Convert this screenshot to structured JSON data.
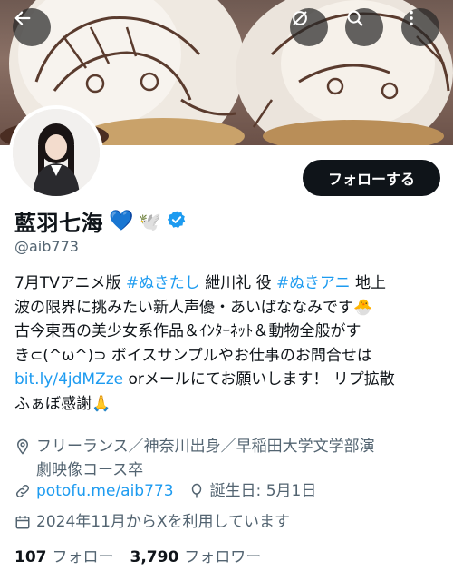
{
  "banner": {
    "back_icon": "arrow-left-icon",
    "hide_icon": "eye-slash-icon",
    "search_icon": "search-icon",
    "more_icon": "more-vertical-icon"
  },
  "profile": {
    "display_name": "藍羽七海",
    "name_emojis": [
      "💙",
      "🕊️"
    ],
    "verified_badge_color": "#1d9bf0",
    "handle": "@aib773",
    "follow_button": "フォローする"
  },
  "bio": {
    "l1_a": "7月TVアニメ版 ",
    "l1_hashtag1": "#ぬきたし",
    "l1_b": " 紲川礼 役 ",
    "l1_hashtag2": "#ぬきアニ",
    "l1_c": " 地上",
    "l2": "波の限界に挑みたい新人声優・あいばななみです🐣",
    "l3": "古今東西の美少女系作品＆ｲﾝﾀｰﾈｯﾄ＆動物全般がす",
    "l4": "き⊂(^ω^)⊃ ボイスサンプルやお仕事のお問合せは",
    "l5_link": "bit.ly/4jdMZze",
    "l5_rest": " orメールにてお願いします！ リプ拡散",
    "l6": "ふぁぼ感謝🙏"
  },
  "meta": {
    "location_l1": "フリーランス／神奈川出身／早稲田大学文学部演",
    "location_l2": "劇映像コース卒",
    "website": "potofu.me/aib773",
    "birthday": "誕生日: 5月1日",
    "joined": "2024年11月からXを利用しています"
  },
  "stats": {
    "following_count": "107",
    "following_label": "フォロー",
    "followers_count": "3,790",
    "followers_label": "フォロワー"
  },
  "colors": {
    "accent": "#1d9bf0",
    "text": "#0f1419",
    "muted": "#536471"
  }
}
